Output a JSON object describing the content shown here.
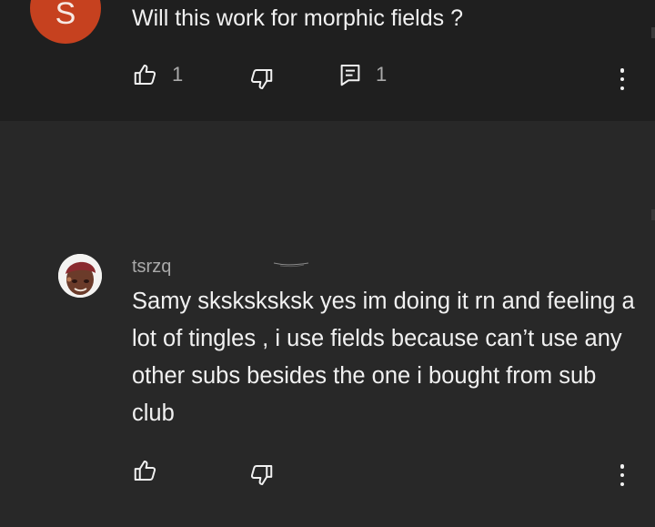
{
  "comments": [
    {
      "avatar_letter": "S",
      "avatar_color": "#c6411f",
      "text": "Will this work for morphic fields ?",
      "likes": "1",
      "replies": "1"
    },
    {
      "username": "tsrzq",
      "text": "Samy sksksksksk yes im doing it rn and feeling a lot of tingles , i use fields because can’t use any other subs besides the one i bought from sub club"
    }
  ],
  "icons": {
    "like": "thumbs-up-icon",
    "dislike": "thumbs-down-icon",
    "reply": "reply-comment-icon",
    "more": "more-vert-icon"
  },
  "colors": {
    "background": "#282828",
    "top_comment_bg": "#1f1f1f",
    "text": "#f1f1f1",
    "secondary_text": "#aaaaaa"
  }
}
